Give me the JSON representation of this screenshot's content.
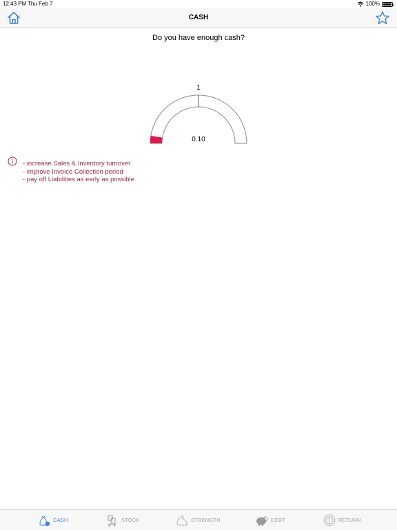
{
  "status_bar": {
    "time": "12:43 PM",
    "date": "Thu Feb 7",
    "battery": "100%"
  },
  "nav": {
    "title": "CASH",
    "left_icon": "home-icon",
    "right_icon": "star-icon"
  },
  "main": {
    "question": "Do you have enough cash?",
    "gauge": {
      "min": 0,
      "max": 2,
      "target": 1,
      "target_label": "1",
      "value": 0.1,
      "value_label": "0.10",
      "value_color": "#e0174a"
    },
    "tips": [
      "- increase Sales & Inventory turnover",
      "- improve Invoice Collection period",
      "- pay off Liabilities as early as possible"
    ],
    "tip_color": "#9b2c46"
  },
  "tabs": [
    {
      "label": "CASH",
      "icon": "cash-bag-icon",
      "active": true
    },
    {
      "label": "STOCK",
      "icon": "stock-cart-icon",
      "active": false
    },
    {
      "label": "STRENGTH",
      "icon": "strength-arm-icon",
      "active": false
    },
    {
      "label": "DEBT",
      "icon": "debt-piggy-icon",
      "active": false
    },
    {
      "label": "RETURN",
      "icon": "return-coin-icon",
      "active": false
    }
  ],
  "colors": {
    "accent": "#3c85d6",
    "inactive": "#9a9a9a"
  }
}
